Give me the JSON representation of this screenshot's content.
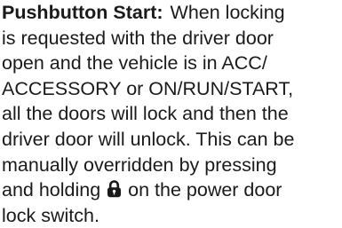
{
  "heading": "Pushbutton Start:",
  "lines": [
    "When locking",
    "is requested with the driver door",
    "open and the vehicle is in ACC/",
    "ACCESSORY or ON/RUN/START,",
    "all the doors will lock and then the",
    "driver door will unlock. This can be",
    "manually overridden by pressing",
    "and holding",
    "on the power door",
    "lock switch."
  ],
  "icons": {
    "lock": "lock-icon"
  }
}
